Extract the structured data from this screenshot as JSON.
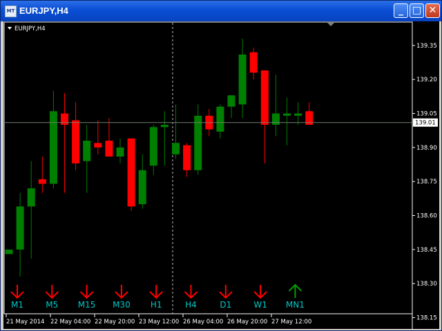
{
  "window": {
    "title": "EURJPY,H4",
    "icon": "mt4-app-icon",
    "controls": {
      "minimize": "_",
      "maximize": "□",
      "close": "✕"
    }
  },
  "chart": {
    "symbol_label": "EURJPY,H4",
    "current_price": "139.01",
    "colors": {
      "background": "#000000",
      "bull": "#008000",
      "bear": "#ff0000",
      "axis": "#ffffff",
      "current_price_line": "#708070",
      "arrow_down": "#ff0000",
      "arrow_up": "#00a000",
      "tf_label": "#00c8c8"
    },
    "price_ticks": [
      "139.35",
      "139.20",
      "139.05",
      "138.90",
      "138.75",
      "138.60",
      "138.45",
      "138.30",
      "138.15"
    ],
    "time_ticks": [
      "21 May 2014",
      "22 May 04:00",
      "22 May 20:00",
      "23 May 12:00",
      "26 May 04:00",
      "26 May 20:00",
      "27 May 12:00"
    ],
    "timeframe_signals": [
      {
        "label": "M1",
        "direction": "down"
      },
      {
        "label": "M5",
        "direction": "down"
      },
      {
        "label": "M15",
        "direction": "down"
      },
      {
        "label": "M30",
        "direction": "down"
      },
      {
        "label": "H1",
        "direction": "down"
      },
      {
        "label": "H4",
        "direction": "down"
      },
      {
        "label": "D1",
        "direction": "down"
      },
      {
        "label": "W1",
        "direction": "down"
      },
      {
        "label": "MN1",
        "direction": "up"
      }
    ]
  },
  "chart_data": {
    "type": "candlestick",
    "y_range": [
      138.1,
      139.45
    ],
    "current_price": 139.01,
    "candles": [
      {
        "o": 138.43,
        "h": 138.43,
        "l": 138.43,
        "c": 138.45
      },
      {
        "o": 138.45,
        "h": 138.7,
        "l": 138.33,
        "c": 138.64
      },
      {
        "o": 138.64,
        "h": 138.84,
        "l": 138.41,
        "c": 138.72
      },
      {
        "o": 138.76,
        "h": 138.86,
        "l": 138.7,
        "c": 138.74
      },
      {
        "o": 138.74,
        "h": 139.15,
        "l": 138.72,
        "c": 139.06
      },
      {
        "o": 139.05,
        "h": 139.14,
        "l": 138.7,
        "c": 139.0
      },
      {
        "o": 139.02,
        "h": 139.1,
        "l": 138.8,
        "c": 138.83
      },
      {
        "o": 138.84,
        "h": 139.0,
        "l": 138.7,
        "c": 138.93
      },
      {
        "o": 138.92,
        "h": 139.02,
        "l": 138.87,
        "c": 138.9
      },
      {
        "o": 138.93,
        "h": 139.03,
        "l": 138.86,
        "c": 138.86
      },
      {
        "o": 138.86,
        "h": 138.94,
        "l": 138.83,
        "c": 138.9
      },
      {
        "o": 138.94,
        "h": 138.94,
        "l": 138.62,
        "c": 138.64
      },
      {
        "o": 138.65,
        "h": 138.87,
        "l": 138.63,
        "c": 138.8
      },
      {
        "o": 138.82,
        "h": 139.0,
        "l": 138.78,
        "c": 138.99
      },
      {
        "o": 138.99,
        "h": 139.06,
        "l": 138.82,
        "c": 139.0
      },
      {
        "o": 138.87,
        "h": 139.09,
        "l": 138.85,
        "c": 138.92
      },
      {
        "o": 138.91,
        "h": 138.92,
        "l": 138.77,
        "c": 138.8
      },
      {
        "o": 138.8,
        "h": 139.09,
        "l": 138.78,
        "c": 139.04
      },
      {
        "o": 139.04,
        "h": 139.07,
        "l": 138.95,
        "c": 138.98
      },
      {
        "o": 138.97,
        "h": 139.09,
        "l": 138.94,
        "c": 139.08
      },
      {
        "o": 139.08,
        "h": 139.13,
        "l": 139.03,
        "c": 139.13
      },
      {
        "o": 139.09,
        "h": 139.38,
        "l": 139.03,
        "c": 139.31
      },
      {
        "o": 139.32,
        "h": 139.34,
        "l": 139.2,
        "c": 139.23
      },
      {
        "o": 139.24,
        "h": 139.24,
        "l": 138.83,
        "c": 139.0
      },
      {
        "o": 139.0,
        "h": 139.22,
        "l": 138.95,
        "c": 139.05
      },
      {
        "o": 139.04,
        "h": 139.12,
        "l": 138.91,
        "c": 139.05
      },
      {
        "o": 139.04,
        "h": 139.1,
        "l": 139.0,
        "c": 139.05
      },
      {
        "o": 139.06,
        "h": 139.1,
        "l": 139.0,
        "c": 139.0
      }
    ]
  }
}
